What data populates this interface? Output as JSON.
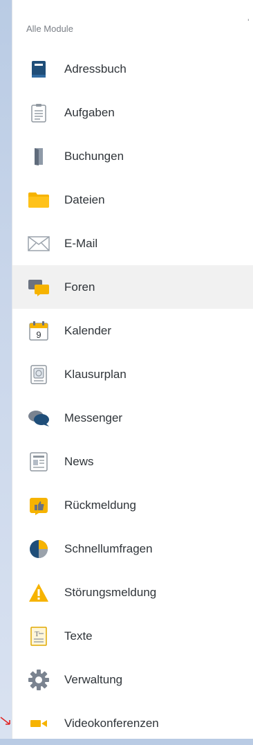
{
  "panel": {
    "header": "Alle Module",
    "items": [
      {
        "label": "Adressbuch",
        "icon": "addressbook-icon"
      },
      {
        "label": "Aufgaben",
        "icon": "tasks-icon"
      },
      {
        "label": "Buchungen",
        "icon": "booking-icon"
      },
      {
        "label": "Dateien",
        "icon": "folder-icon"
      },
      {
        "label": "E-Mail",
        "icon": "mail-icon"
      },
      {
        "label": "Foren",
        "icon": "forum-icon"
      },
      {
        "label": "Kalender",
        "icon": "calendar-icon"
      },
      {
        "label": "Klausurplan",
        "icon": "exam-plan-icon"
      },
      {
        "label": "Messenger",
        "icon": "messenger-icon"
      },
      {
        "label": "News",
        "icon": "news-icon"
      },
      {
        "label": "Rückmeldung",
        "icon": "feedback-icon"
      },
      {
        "label": "Schnellumfragen",
        "icon": "quick-poll-icon"
      },
      {
        "label": "Störungsmeldung",
        "icon": "warning-icon"
      },
      {
        "label": "Texte",
        "icon": "text-icon"
      },
      {
        "label": "Verwaltung",
        "icon": "gear-icon"
      },
      {
        "label": "Videokonferenzen",
        "icon": "video-icon"
      }
    ],
    "active_item": "Foren"
  },
  "calendar_icon_day": "9",
  "colors": {
    "navy": "#1f4e79",
    "yellow": "#f6b300",
    "gray": "#7a7f86",
    "highlight": "#f1f1f1",
    "arrow": "#e02424"
  }
}
